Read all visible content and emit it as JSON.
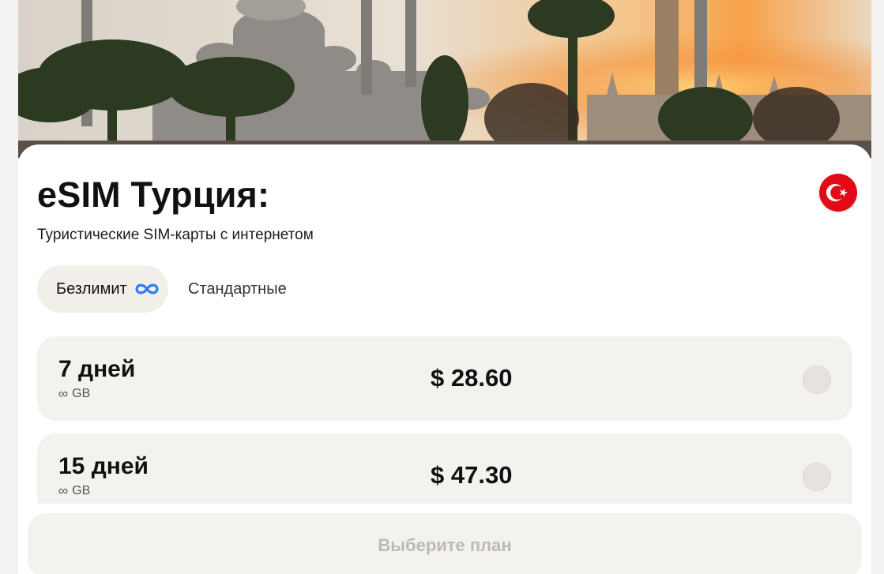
{
  "header": {
    "title": "eSIM Турция:",
    "subtitle": "Туристические SIM-карты с интернетом",
    "flag": "turkey-flag-icon"
  },
  "tabs": [
    {
      "label": "Безлимит",
      "icon": "infinity-icon",
      "active": true
    },
    {
      "label": "Стандартные",
      "active": false
    }
  ],
  "plans": [
    {
      "days": "7 дней",
      "data_symbol": "∞",
      "data_unit": "GB",
      "price": "$ 28.60",
      "selected": false
    },
    {
      "days": "15 дней",
      "data_symbol": "∞",
      "data_unit": "GB",
      "price": "$ 47.30",
      "selected": false
    }
  ],
  "footer": {
    "cta_label": "Выберите план"
  },
  "colors": {
    "accent_infinity": "#2f7bf5",
    "flag_red": "#e30a17",
    "card_bg": "#f4f2ef",
    "cta_text_disabled": "#bdbab6"
  }
}
